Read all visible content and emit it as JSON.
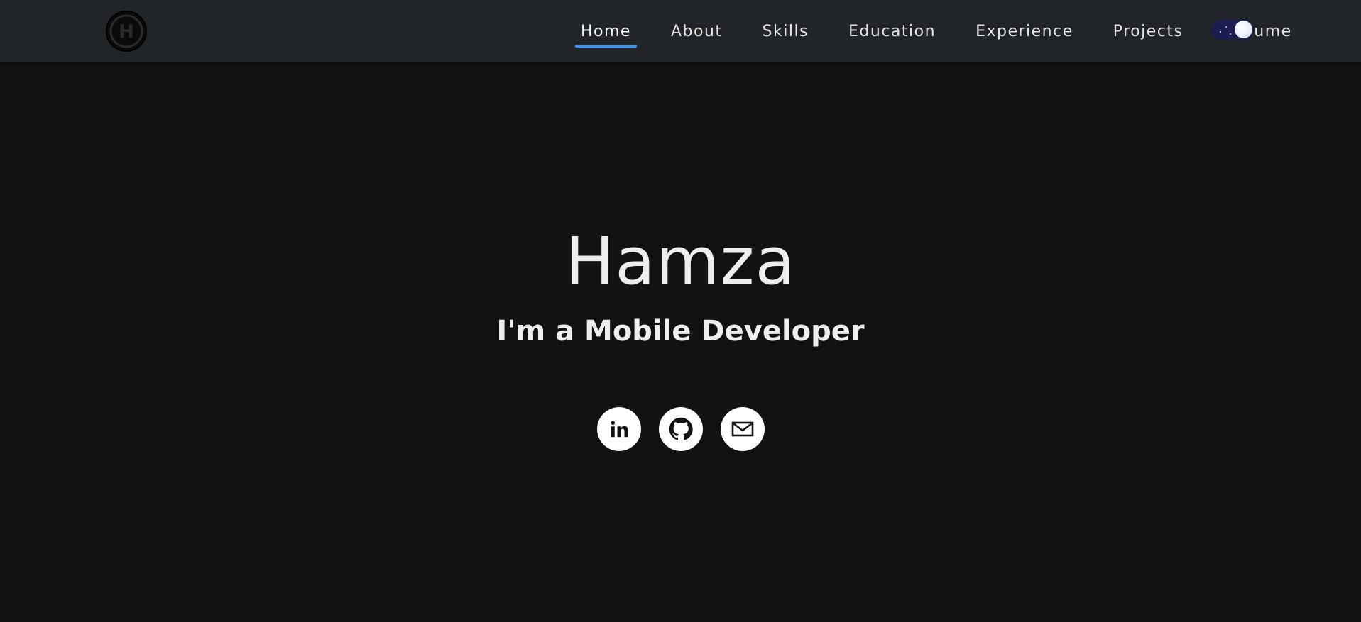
{
  "logo": {
    "letter": "H"
  },
  "nav": {
    "items": [
      {
        "label": "Home",
        "active": true
      },
      {
        "label": "About",
        "active": false
      },
      {
        "label": "Skills",
        "active": false
      },
      {
        "label": "Education",
        "active": false
      },
      {
        "label": "Experience",
        "active": false
      },
      {
        "label": "Projects",
        "active": false
      },
      {
        "label": "Resume",
        "active": false
      }
    ],
    "theme_toggle": {
      "mode": "dark",
      "icon": "moon-icon"
    }
  },
  "hero": {
    "name": "Hamza",
    "subtitle": "I'm a Mobile Developer"
  },
  "socials": [
    {
      "icon": "linkedin-icon"
    },
    {
      "icon": "github-icon"
    },
    {
      "icon": "mail-icon"
    }
  ],
  "colors": {
    "background": "#121212",
    "navbar": "#212429",
    "accent": "#4a90e2",
    "text": "#eeeeee"
  }
}
